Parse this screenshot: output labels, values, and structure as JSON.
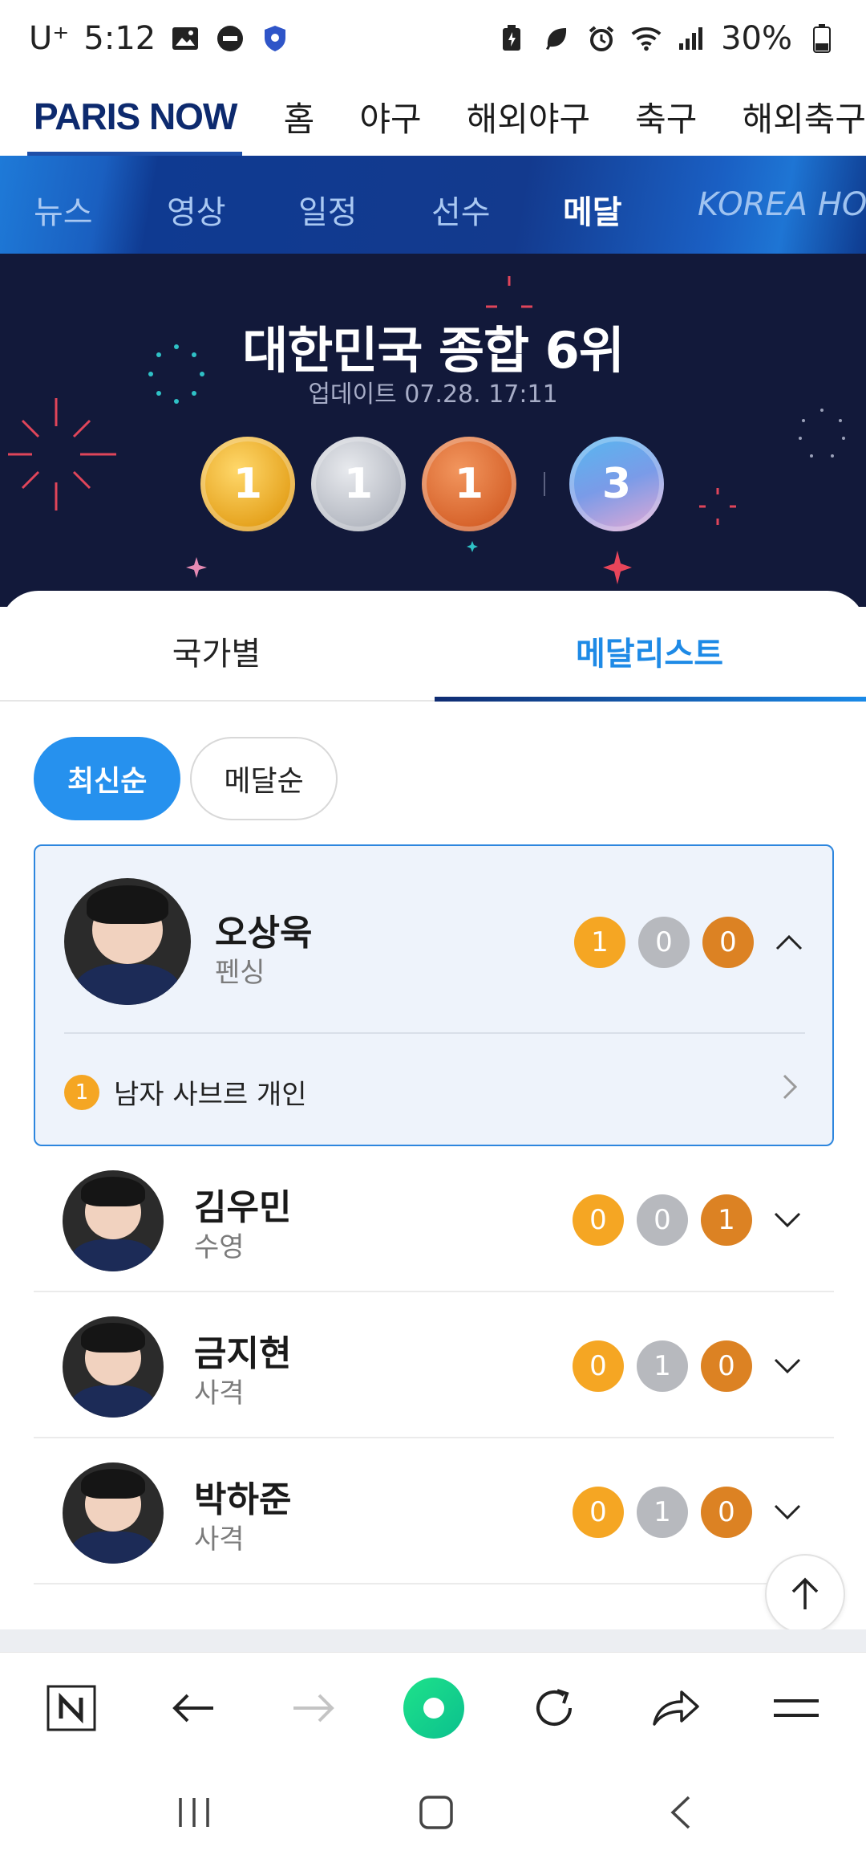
{
  "status": {
    "carrier": "U⁺",
    "time": "5:12",
    "battery": "30%"
  },
  "brand": "PARIS NOW",
  "top_nav": [
    "홈",
    "야구",
    "해외야구",
    "축구",
    "해외축구"
  ],
  "sub_nav": [
    {
      "label": "뉴스"
    },
    {
      "label": "영상"
    },
    {
      "label": "일정"
    },
    {
      "label": "선수"
    },
    {
      "label": "메달",
      "active": true
    },
    {
      "label": "KOREA HOU"
    }
  ],
  "hero": {
    "title": "대한민국 종합 6위",
    "updated": "업데이트 07.28. 17:11",
    "medals": {
      "gold": "1",
      "silver": "1",
      "bronze": "1",
      "total": "3"
    }
  },
  "tabs": {
    "by_country": "국가별",
    "medalists": "메달리스트"
  },
  "chips": {
    "latest": "최신순",
    "by_medal": "메달순"
  },
  "athletes": [
    {
      "name": "오상욱",
      "sport": "펜싱",
      "gold": "1",
      "silver": "0",
      "bronze": "0",
      "expanded": true,
      "event": {
        "medal": "1",
        "name": "남자 사브르 개인"
      }
    },
    {
      "name": "김우민",
      "sport": "수영",
      "gold": "0",
      "silver": "0",
      "bronze": "1"
    },
    {
      "name": "금지현",
      "sport": "사격",
      "gold": "0",
      "silver": "1",
      "bronze": "0"
    },
    {
      "name": "박하준",
      "sport": "사격",
      "gold": "0",
      "silver": "1",
      "bronze": "0"
    }
  ],
  "colors": {
    "accent": "#2691ee",
    "brand_navy": "#0d2a6e",
    "gold": "#f5a623",
    "silver": "#b7b9be",
    "bronze": "#dc8223"
  }
}
